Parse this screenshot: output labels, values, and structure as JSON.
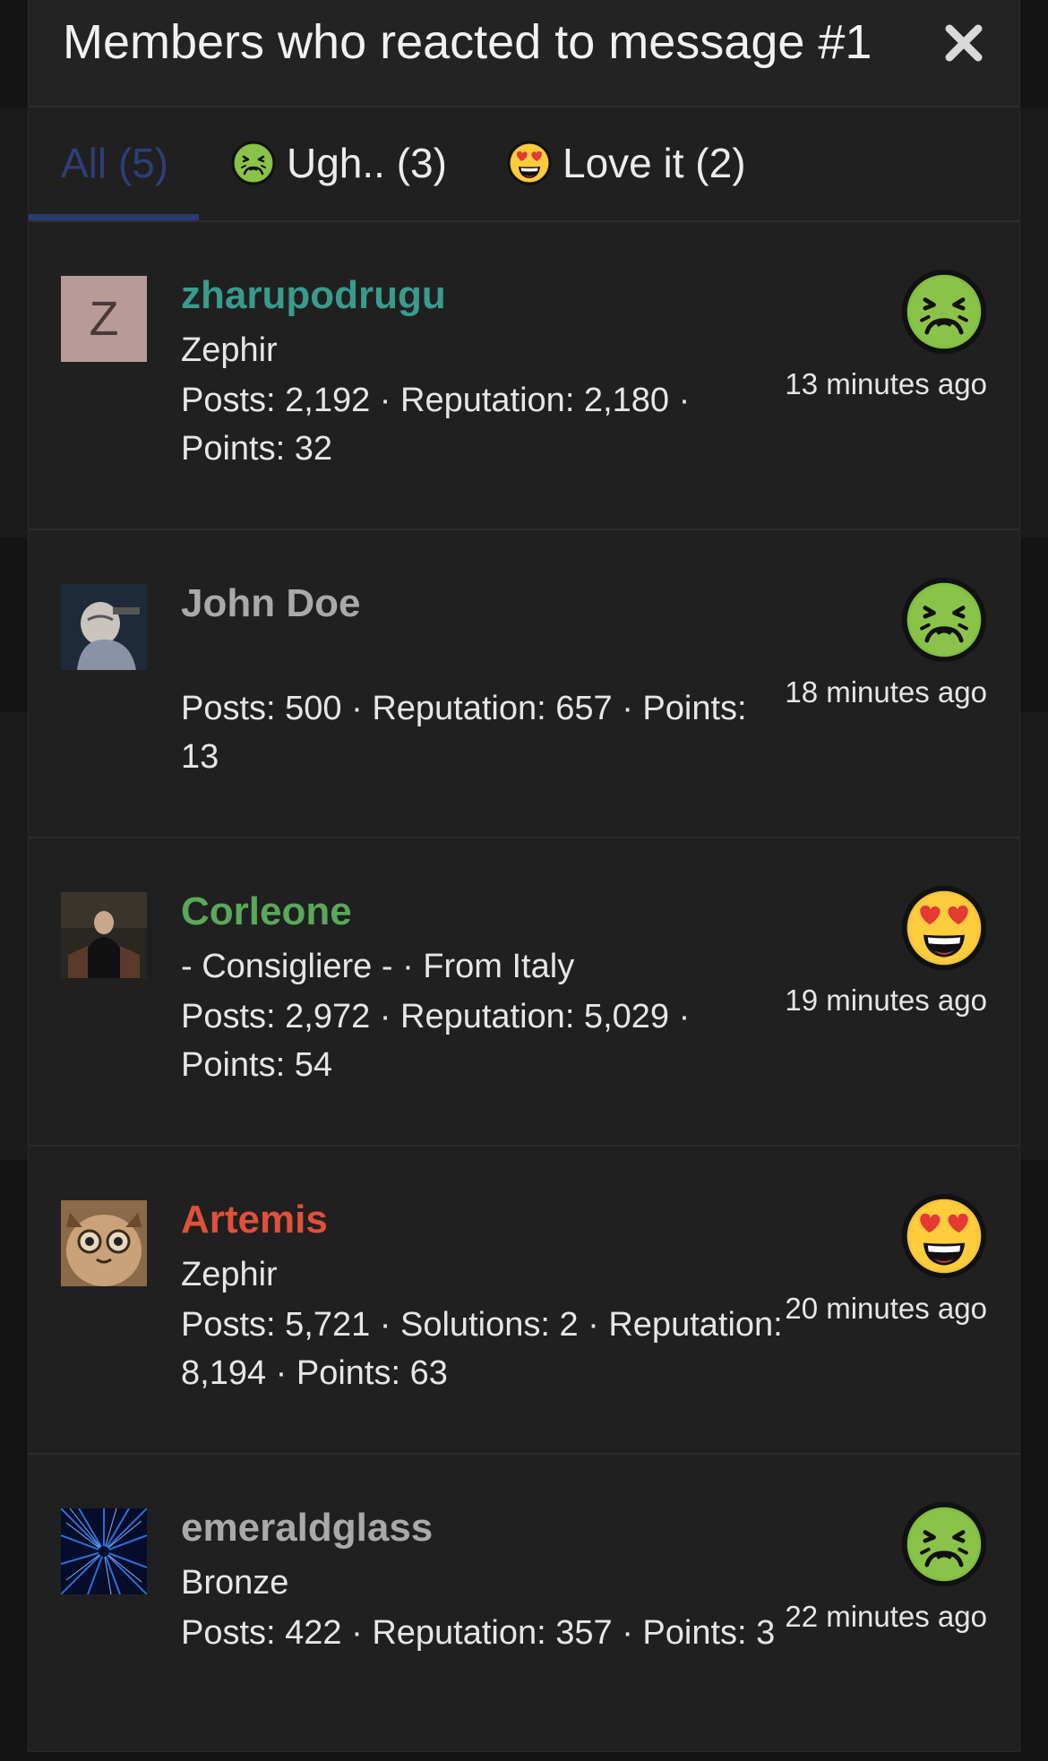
{
  "dialog": {
    "title": "Members who reacted to message #1",
    "close_label": "close"
  },
  "tabs": [
    {
      "label": "All (5)",
      "active": true
    },
    {
      "label": "Ugh.. (3)",
      "emoji": "nauseated-face-icon"
    },
    {
      "label": "Love it (2)",
      "emoji": "heart-eyes-face-icon"
    }
  ],
  "colors": {
    "active_tab": "#2f3e77",
    "name_teal": "#3a9a8c",
    "name_gray": "#a9a9a9",
    "name_green": "#5aa85a",
    "name_red": "#e0503a",
    "avatar_placeholder_bg": "#b89a98"
  },
  "members": [
    {
      "name": "zharupodrugu",
      "name_color": "#3a9a8c",
      "avatar_letter": "Z",
      "title": "Zephir",
      "stats": "Posts: 2,192 · Reputation: 2,180 · Points: 32",
      "reaction": "nauseated-face-icon",
      "time": "13 minutes ago"
    },
    {
      "name": "John Doe",
      "name_color": "#a9a9a9",
      "title": "",
      "stats": "Posts: 500 · Reputation: 657 · Points: 13",
      "reaction": "nauseated-face-icon",
      "time": "18 minutes ago"
    },
    {
      "name": "Corleone",
      "name_color": "#5aa85a",
      "title": "- Consigliere - · From Italy",
      "stats": "Posts: 2,972 · Reputation: 5,029 · Points: 54",
      "reaction": "heart-eyes-face-icon",
      "time": "19 minutes ago"
    },
    {
      "name": "Artemis",
      "name_color": "#e0503a",
      "title": "Zephir",
      "stats": "Posts: 5,721 · Solutions: 2 · Reputation: 8,194 · Points: 63",
      "reaction": "heart-eyes-face-icon",
      "time": "20 minutes ago"
    },
    {
      "name": "emeraldglass",
      "name_color": "#a9a9a9",
      "title": "Bronze",
      "stats": "Posts: 422 · Reputation: 357 · Points: 3",
      "reaction": "nauseated-face-icon",
      "time": "22 minutes ago"
    }
  ]
}
